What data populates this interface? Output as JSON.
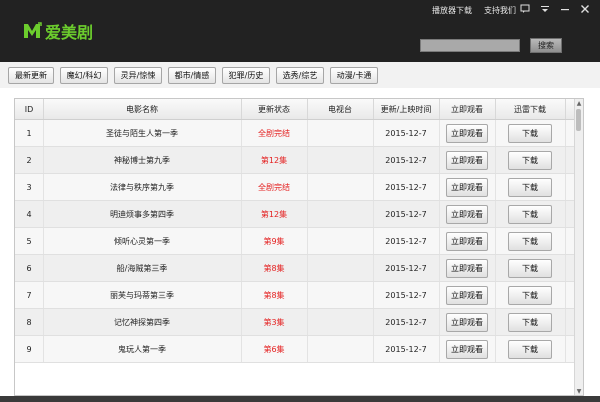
{
  "app": {
    "logo_text": "爱美剧",
    "brand_color": "#6ccd2d",
    "status_color": "#e41f1f"
  },
  "header": {
    "links": [
      "播放器下载",
      "支持我们"
    ],
    "controls": [
      "chat-icon",
      "menu-icon",
      "minimize-icon",
      "close-icon"
    ],
    "search_value": "",
    "search_label": "搜索"
  },
  "categories": [
    "最新更新",
    "魔幻/科幻",
    "灵异/惊悚",
    "都市/情感",
    "犯罪/历史",
    "选秀/综艺",
    "动漫/卡通"
  ],
  "table": {
    "columns": [
      "ID",
      "电影名称",
      "更新状态",
      "电视台",
      "更新/上映时间",
      "立即观看",
      "迅雷下载"
    ],
    "watch_label": "立即观看",
    "download_label": "下载",
    "rows": [
      {
        "id": "1",
        "name": "圣徒与陌生人第一季",
        "status": "全剧完结",
        "tv": "",
        "date": "2015-12-7"
      },
      {
        "id": "2",
        "name": "神秘博士第九季",
        "status": "第12集",
        "tv": "",
        "date": "2015-12-7"
      },
      {
        "id": "3",
        "name": "法律与秩序第九季",
        "status": "全剧完结",
        "tv": "",
        "date": "2015-12-7"
      },
      {
        "id": "4",
        "name": "明迪烦事多第四季",
        "status": "第12集",
        "tv": "",
        "date": "2015-12-7"
      },
      {
        "id": "5",
        "name": "倾听心灵第一季",
        "status": "第9集",
        "tv": "",
        "date": "2015-12-7"
      },
      {
        "id": "6",
        "name": "船/海贼第三季",
        "status": "第8集",
        "tv": "",
        "date": "2015-12-7"
      },
      {
        "id": "7",
        "name": "丽芙与玛蒂第三季",
        "status": "第8集",
        "tv": "",
        "date": "2015-12-7"
      },
      {
        "id": "8",
        "name": "记忆神探第四季",
        "status": "第3集",
        "tv": "",
        "date": "2015-12-7"
      },
      {
        "id": "9",
        "name": "鬼玩人第一季",
        "status": "第6集",
        "tv": "",
        "date": "2015-12-7"
      }
    ]
  }
}
